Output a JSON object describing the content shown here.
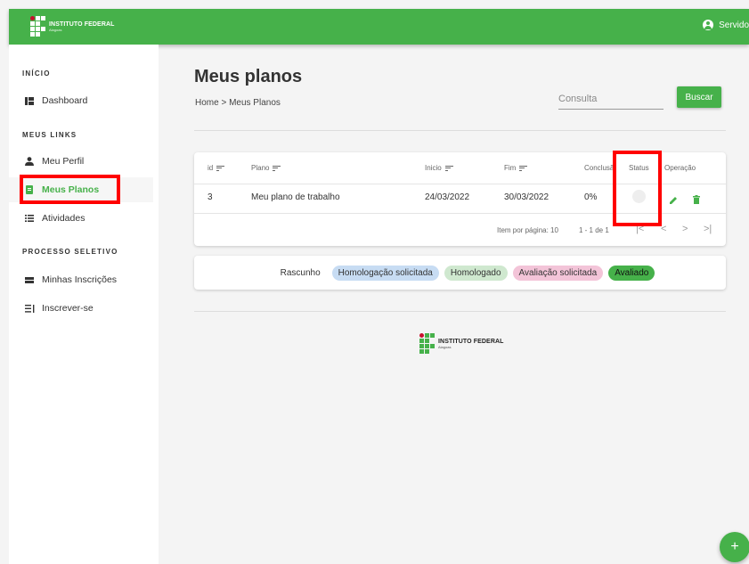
{
  "header": {
    "logo_title": "INSTITUTO FEDERAL",
    "logo_subtitle": "Alagoas",
    "user_label": "Servido",
    "brand_color": "#46b14a"
  },
  "sidebar": {
    "sections": [
      {
        "title": "INÍCIO",
        "items": [
          {
            "label": "Dashboard",
            "icon": "dashboard-icon"
          }
        ]
      },
      {
        "title": "MEUS LINKS",
        "items": [
          {
            "label": "Meu Perfil",
            "icon": "person-icon"
          },
          {
            "label": "Meus Planos",
            "icon": "document-icon",
            "active": true
          },
          {
            "label": "Atividades",
            "icon": "list-icon"
          }
        ]
      },
      {
        "title": "PROCESSO SELETIVO",
        "items": [
          {
            "label": "Minhas Inscrições",
            "icon": "card-icon"
          },
          {
            "label": "Inscrever-se",
            "icon": "form-list-icon"
          }
        ]
      }
    ]
  },
  "main": {
    "title": "Meus planos",
    "breadcrumb": "Home > Meus Planos",
    "search_placeholder": "Consulta",
    "search_button": "Buscar"
  },
  "table": {
    "columns": [
      "id",
      "Plano",
      "Inicio",
      "Fim",
      "Conclusã",
      "Status",
      "Operação"
    ],
    "rows": [
      {
        "id": "3",
        "plano": "Meu plano de trabalho",
        "inicio": "24/03/2022",
        "fim": "30/03/2022",
        "conclusao": "0%"
      }
    ],
    "items_per_page": "Item por página: 10",
    "range": "1 - 1 de 1"
  },
  "legend": [
    {
      "label": "Rascunho",
      "color": "#ffffff"
    },
    {
      "label": "Homologação solicitada",
      "color": "#c7dcf3"
    },
    {
      "label": "Homologado",
      "color": "#cfe8cf"
    },
    {
      "label": "Avaliação solicitada",
      "color": "#f3c4d8"
    },
    {
      "label": "Avaliado",
      "color": "#46b14a"
    }
  ],
  "footer": {
    "logo_title": "INSTITUTO FEDERAL",
    "logo_subtitle": "Alagoas"
  },
  "fab_label": "+"
}
